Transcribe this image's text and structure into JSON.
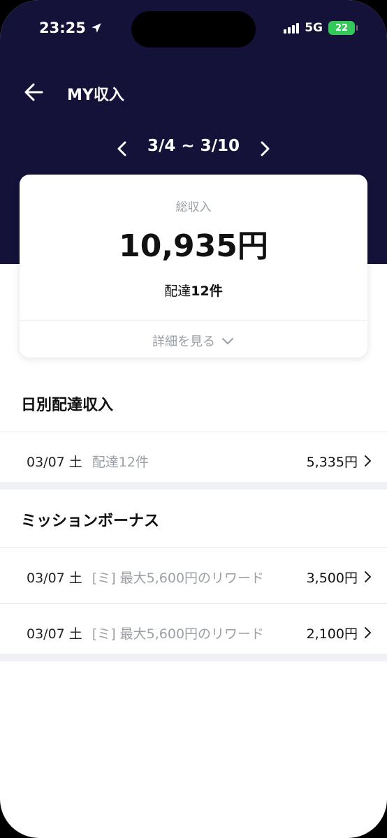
{
  "status_bar": {
    "time": "23:25",
    "network": "5G",
    "battery": "22"
  },
  "nav": {
    "title": "MY収入"
  },
  "date_switcher": {
    "range": "3/4 ~ 3/10"
  },
  "summary": {
    "label": "総収入",
    "total": "10,935円",
    "count_prefix": "配達",
    "count_value": "12件",
    "detail_link": "詳細を見る"
  },
  "daily": {
    "title": "日別配達収入",
    "rows": [
      {
        "date": "03/07 土",
        "desc": "配達12件",
        "amount": "5,335円"
      }
    ]
  },
  "mission": {
    "title": "ミッションボーナス",
    "rows": [
      {
        "date": "03/07 土",
        "desc": "[ミ] 最大5,600円のリワード",
        "amount": "3,500円"
      },
      {
        "date": "03/07 土",
        "desc": "[ミ] 最大5,600円のリワード",
        "amount": "2,100円"
      }
    ]
  },
  "colors": {
    "header": "#15123a",
    "muted": "#9aa0a6",
    "battery": "#34c759"
  }
}
